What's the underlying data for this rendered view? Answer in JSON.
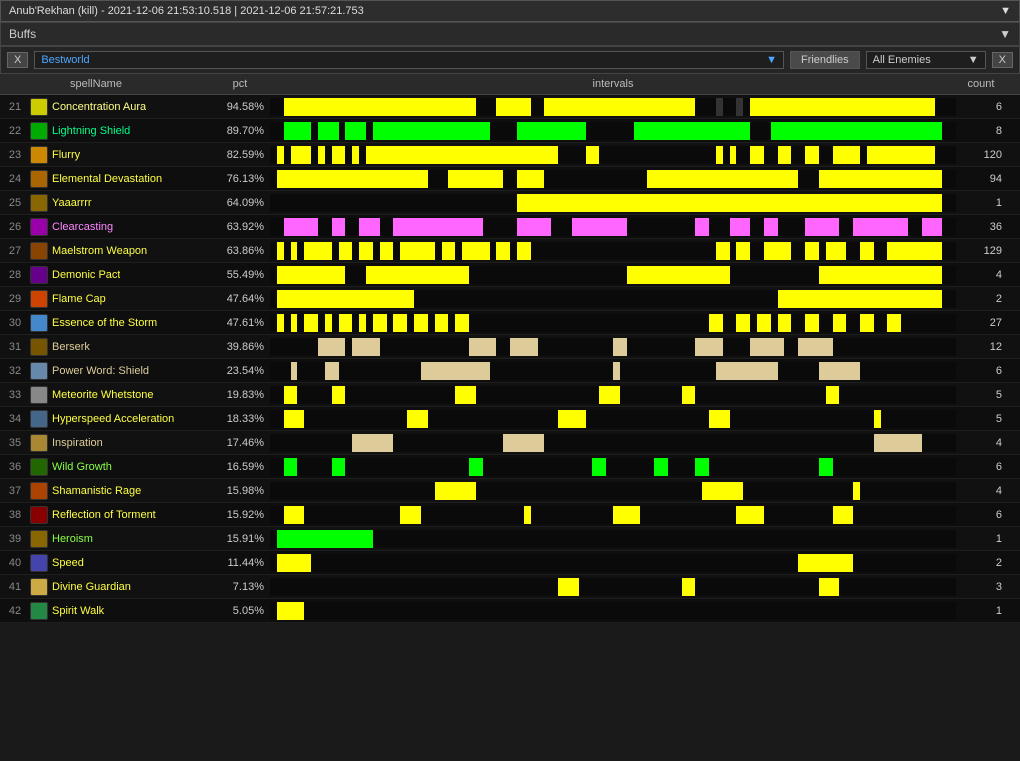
{
  "titleBar": {
    "text": "Anub'Rekhan (kill) - 2021-12-06 21:53:10.518 | 2021-12-06 21:57:21.753",
    "chevron": "▼"
  },
  "sectionHeader": {
    "label": "Buffs",
    "chevron": "▼"
  },
  "filterBar": {
    "xLabel": "X",
    "playerName": "Bestworld",
    "friendliesLabel": "Friendlies",
    "allEnemiesLabel": "All Enemies",
    "closeLabel": "X"
  },
  "tableHeader": {
    "spellName": "spellName",
    "pct": "pct",
    "intervals": "intervals",
    "count": "count"
  },
  "rows": [
    {
      "num": "21",
      "name": "Concentration Aura",
      "pct": "94.58%",
      "count": "6",
      "color": "#ffff00",
      "iconColor": "#cccc00",
      "nameColor": "#ffff88",
      "bars": [
        {
          "left": 0.02,
          "width": 0.28,
          "color": "#ffff00"
        },
        {
          "left": 0.33,
          "width": 0.05,
          "color": "#ffff00"
        },
        {
          "left": 0.4,
          "width": 0.22,
          "color": "#ffff00"
        },
        {
          "left": 0.65,
          "width": 0.01,
          "color": "#333"
        },
        {
          "left": 0.68,
          "width": 0.01,
          "color": "#333"
        },
        {
          "left": 0.7,
          "width": 0.27,
          "color": "#ffff00"
        }
      ]
    },
    {
      "num": "22",
      "name": "Lightning Shield",
      "pct": "89.70%",
      "count": "8",
      "color": "#00ff00",
      "iconColor": "#00aa00",
      "nameColor": "#00ff88",
      "bars": [
        {
          "left": 0.02,
          "width": 0.04,
          "color": "#00ff00"
        },
        {
          "left": 0.07,
          "width": 0.03,
          "color": "#00ff00"
        },
        {
          "left": 0.11,
          "width": 0.03,
          "color": "#00ff00"
        },
        {
          "left": 0.15,
          "width": 0.17,
          "color": "#00ff00"
        },
        {
          "left": 0.36,
          "width": 0.1,
          "color": "#00ff00"
        },
        {
          "left": 0.53,
          "width": 0.17,
          "color": "#00ff00"
        },
        {
          "left": 0.73,
          "width": 0.25,
          "color": "#00ff00"
        }
      ]
    },
    {
      "num": "23",
      "name": "Flurry",
      "pct": "82.59%",
      "count": "120",
      "color": "#ffff00",
      "iconColor": "#cc8800",
      "nameColor": "#ffff44",
      "bars": [
        {
          "left": 0.01,
          "width": 0.01,
          "color": "#ffff00"
        },
        {
          "left": 0.03,
          "width": 0.01,
          "color": "#ffff00"
        },
        {
          "left": 0.04,
          "width": 0.01,
          "color": "#ffff00"
        },
        {
          "left": 0.05,
          "width": 0.01,
          "color": "#ffff00"
        },
        {
          "left": 0.07,
          "width": 0.01,
          "color": "#ffff00"
        },
        {
          "left": 0.09,
          "width": 0.02,
          "color": "#ffff00"
        },
        {
          "left": 0.12,
          "width": 0.01,
          "color": "#ffff00"
        },
        {
          "left": 0.14,
          "width": 0.28,
          "color": "#ffff00"
        },
        {
          "left": 0.46,
          "width": 0.02,
          "color": "#ffff00"
        },
        {
          "left": 0.65,
          "width": 0.01,
          "color": "#ffff00"
        },
        {
          "left": 0.67,
          "width": 0.01,
          "color": "#ffff00"
        },
        {
          "left": 0.7,
          "width": 0.02,
          "color": "#ffff00"
        },
        {
          "left": 0.74,
          "width": 0.02,
          "color": "#ffff00"
        },
        {
          "left": 0.78,
          "width": 0.02,
          "color": "#ffff00"
        },
        {
          "left": 0.82,
          "width": 0.04,
          "color": "#ffff00"
        },
        {
          "left": 0.87,
          "width": 0.1,
          "color": "#ffff00"
        }
      ]
    },
    {
      "num": "24",
      "name": "Elemental Devastation",
      "pct": "76.13%",
      "count": "94",
      "color": "#ffff00",
      "iconColor": "#aa6600",
      "nameColor": "#ffff44",
      "bars": [
        {
          "left": 0.01,
          "width": 0.22,
          "color": "#ffff00"
        },
        {
          "left": 0.26,
          "width": 0.08,
          "color": "#ffff00"
        },
        {
          "left": 0.36,
          "width": 0.04,
          "color": "#ffff00"
        },
        {
          "left": 0.55,
          "width": 0.22,
          "color": "#ffff00"
        },
        {
          "left": 0.8,
          "width": 0.18,
          "color": "#ffff00"
        }
      ]
    },
    {
      "num": "25",
      "name": "Yaaarrrr",
      "pct": "64.09%",
      "count": "1",
      "color": "#ffff00",
      "iconColor": "#886600",
      "nameColor": "#ffff44",
      "bars": [
        {
          "left": 0.36,
          "width": 0.62,
          "color": "#ffff00"
        }
      ]
    },
    {
      "num": "26",
      "name": "Clearcasting",
      "pct": "63.92%",
      "count": "36",
      "color": "#ff66ff",
      "iconColor": "#9900aa",
      "nameColor": "#ff88ff",
      "bars": [
        {
          "left": 0.02,
          "width": 0.05,
          "color": "#ff66ff"
        },
        {
          "left": 0.09,
          "width": 0.02,
          "color": "#ff66ff"
        },
        {
          "left": 0.13,
          "width": 0.03,
          "color": "#ff66ff"
        },
        {
          "left": 0.18,
          "width": 0.13,
          "color": "#ff66ff"
        },
        {
          "left": 0.36,
          "width": 0.05,
          "color": "#ff66ff"
        },
        {
          "left": 0.44,
          "width": 0.08,
          "color": "#ff66ff"
        },
        {
          "left": 0.62,
          "width": 0.02,
          "color": "#ff66ff"
        },
        {
          "left": 0.67,
          "width": 0.03,
          "color": "#ff66ff"
        },
        {
          "left": 0.72,
          "width": 0.02,
          "color": "#ff66ff"
        },
        {
          "left": 0.78,
          "width": 0.05,
          "color": "#ff66ff"
        },
        {
          "left": 0.85,
          "width": 0.08,
          "color": "#ff66ff"
        },
        {
          "left": 0.95,
          "width": 0.03,
          "color": "#ff66ff"
        }
      ]
    },
    {
      "num": "27",
      "name": "Maelstrom Weapon",
      "pct": "63.86%",
      "count": "129",
      "color": "#ffff00",
      "iconColor": "#884400",
      "nameColor": "#ffff44",
      "bars": [
        {
          "left": 0.01,
          "width": 0.01,
          "color": "#ffff00"
        },
        {
          "left": 0.03,
          "width": 0.01,
          "color": "#ffff00"
        },
        {
          "left": 0.05,
          "width": 0.04,
          "color": "#ffff00"
        },
        {
          "left": 0.1,
          "width": 0.02,
          "color": "#ffff00"
        },
        {
          "left": 0.13,
          "width": 0.02,
          "color": "#ffff00"
        },
        {
          "left": 0.16,
          "width": 0.02,
          "color": "#ffff00"
        },
        {
          "left": 0.19,
          "width": 0.05,
          "color": "#ffff00"
        },
        {
          "left": 0.25,
          "width": 0.02,
          "color": "#ffff00"
        },
        {
          "left": 0.28,
          "width": 0.04,
          "color": "#ffff00"
        },
        {
          "left": 0.33,
          "width": 0.02,
          "color": "#ffff00"
        },
        {
          "left": 0.36,
          "width": 0.02,
          "color": "#ffff00"
        },
        {
          "left": 0.65,
          "width": 0.02,
          "color": "#ffff00"
        },
        {
          "left": 0.68,
          "width": 0.02,
          "color": "#ffff00"
        },
        {
          "left": 0.72,
          "width": 0.04,
          "color": "#ffff00"
        },
        {
          "left": 0.78,
          "width": 0.02,
          "color": "#ffff00"
        },
        {
          "left": 0.81,
          "width": 0.03,
          "color": "#ffff00"
        },
        {
          "left": 0.86,
          "width": 0.02,
          "color": "#ffff00"
        },
        {
          "left": 0.9,
          "width": 0.08,
          "color": "#ffff00"
        }
      ]
    },
    {
      "num": "28",
      "name": "Demonic Pact",
      "pct": "55.49%",
      "count": "4",
      "color": "#ffff00",
      "iconColor": "#660088",
      "nameColor": "#ffff44",
      "bars": [
        {
          "left": 0.01,
          "width": 0.1,
          "color": "#ffff00"
        },
        {
          "left": 0.14,
          "width": 0.15,
          "color": "#ffff00"
        },
        {
          "left": 0.52,
          "width": 0.15,
          "color": "#ffff00"
        },
        {
          "left": 0.8,
          "width": 0.18,
          "color": "#ffff00"
        }
      ]
    },
    {
      "num": "29",
      "name": "Flame Cap",
      "pct": "47.64%",
      "count": "2",
      "color": "#ffff00",
      "iconColor": "#cc4400",
      "nameColor": "#ffff44",
      "bars": [
        {
          "left": 0.01,
          "width": 0.2,
          "color": "#ffff00"
        },
        {
          "left": 0.74,
          "width": 0.24,
          "color": "#ffff00"
        }
      ]
    },
    {
      "num": "30",
      "name": "Essence of the Storm",
      "pct": "47.61%",
      "count": "27",
      "color": "#ffff00",
      "iconColor": "#4488cc",
      "nameColor": "#ffff44",
      "bars": [
        {
          "left": 0.01,
          "width": 0.01,
          "color": "#ffff00"
        },
        {
          "left": 0.03,
          "width": 0.01,
          "color": "#ffff00"
        },
        {
          "left": 0.05,
          "width": 0.02,
          "color": "#ffff00"
        },
        {
          "left": 0.08,
          "width": 0.01,
          "color": "#ffff00"
        },
        {
          "left": 0.1,
          "width": 0.02,
          "color": "#ffff00"
        },
        {
          "left": 0.13,
          "width": 0.01,
          "color": "#ffff00"
        },
        {
          "left": 0.15,
          "width": 0.02,
          "color": "#ffff00"
        },
        {
          "left": 0.18,
          "width": 0.02,
          "color": "#ffff00"
        },
        {
          "left": 0.21,
          "width": 0.02,
          "color": "#ffff00"
        },
        {
          "left": 0.24,
          "width": 0.02,
          "color": "#ffff00"
        },
        {
          "left": 0.27,
          "width": 0.02,
          "color": "#ffff00"
        },
        {
          "left": 0.64,
          "width": 0.02,
          "color": "#ffff00"
        },
        {
          "left": 0.68,
          "width": 0.02,
          "color": "#ffff00"
        },
        {
          "left": 0.71,
          "width": 0.02,
          "color": "#ffff00"
        },
        {
          "left": 0.74,
          "width": 0.02,
          "color": "#ffff00"
        },
        {
          "left": 0.78,
          "width": 0.02,
          "color": "#ffff00"
        },
        {
          "left": 0.82,
          "width": 0.02,
          "color": "#ffff00"
        },
        {
          "left": 0.86,
          "width": 0.02,
          "color": "#ffff00"
        },
        {
          "left": 0.9,
          "width": 0.02,
          "color": "#ffff00"
        }
      ]
    },
    {
      "num": "31",
      "name": "Berserk",
      "pct": "39.86%",
      "count": "12",
      "color": "#ddcc99",
      "iconColor": "#775500",
      "nameColor": "#ddcc99",
      "bars": [
        {
          "left": 0.07,
          "width": 0.04,
          "color": "#ddcc99"
        },
        {
          "left": 0.12,
          "width": 0.04,
          "color": "#ddcc99"
        },
        {
          "left": 0.29,
          "width": 0.04,
          "color": "#ddcc99"
        },
        {
          "left": 0.35,
          "width": 0.04,
          "color": "#ddcc99"
        },
        {
          "left": 0.5,
          "width": 0.02,
          "color": "#ddcc99"
        },
        {
          "left": 0.62,
          "width": 0.04,
          "color": "#ddcc99"
        },
        {
          "left": 0.7,
          "width": 0.05,
          "color": "#ddcc99"
        },
        {
          "left": 0.77,
          "width": 0.05,
          "color": "#ddcc99"
        }
      ]
    },
    {
      "num": "32",
      "name": "Power Word: Shield",
      "pct": "23.54%",
      "count": "6",
      "color": "#ddcc99",
      "iconColor": "#6688aa",
      "nameColor": "#ddcc99",
      "bars": [
        {
          "left": 0.03,
          "width": 0.01,
          "color": "#ddcc99"
        },
        {
          "left": 0.08,
          "width": 0.02,
          "color": "#ddcc99"
        },
        {
          "left": 0.22,
          "width": 0.1,
          "color": "#ddcc99"
        },
        {
          "left": 0.5,
          "width": 0.01,
          "color": "#ddcc99"
        },
        {
          "left": 0.65,
          "width": 0.09,
          "color": "#ddcc99"
        },
        {
          "left": 0.8,
          "width": 0.06,
          "color": "#ddcc99"
        }
      ]
    },
    {
      "num": "33",
      "name": "Meteorite Whetstone",
      "pct": "19.83%",
      "count": "5",
      "color": "#ffff00",
      "iconColor": "#888888",
      "nameColor": "#ffff44",
      "bars": [
        {
          "left": 0.02,
          "width": 0.02,
          "color": "#ffff00"
        },
        {
          "left": 0.09,
          "width": 0.02,
          "color": "#ffff00"
        },
        {
          "left": 0.27,
          "width": 0.03,
          "color": "#ffff00"
        },
        {
          "left": 0.48,
          "width": 0.03,
          "color": "#ffff00"
        },
        {
          "left": 0.6,
          "width": 0.02,
          "color": "#ffff00"
        },
        {
          "left": 0.81,
          "width": 0.02,
          "color": "#ffff00"
        }
      ]
    },
    {
      "num": "34",
      "name": "Hyperspeed Acceleration",
      "pct": "18.33%",
      "count": "5",
      "color": "#ffff00",
      "iconColor": "#446688",
      "nameColor": "#ffff44",
      "bars": [
        {
          "left": 0.02,
          "width": 0.03,
          "color": "#ffff00"
        },
        {
          "left": 0.2,
          "width": 0.03,
          "color": "#ffff00"
        },
        {
          "left": 0.42,
          "width": 0.04,
          "color": "#ffff00"
        },
        {
          "left": 0.64,
          "width": 0.03,
          "color": "#ffff00"
        },
        {
          "left": 0.88,
          "width": 0.01,
          "color": "#ffff00"
        }
      ]
    },
    {
      "num": "35",
      "name": "Inspiration",
      "pct": "17.46%",
      "count": "4",
      "color": "#ddcc99",
      "iconColor": "#aa8833",
      "nameColor": "#ddcc99",
      "bars": [
        {
          "left": 0.12,
          "width": 0.06,
          "color": "#ddcc99"
        },
        {
          "left": 0.34,
          "width": 0.06,
          "color": "#ddcc99"
        },
        {
          "left": 0.88,
          "width": 0.07,
          "color": "#ddcc99"
        }
      ]
    },
    {
      "num": "36",
      "name": "Wild Growth",
      "pct": "16.59%",
      "count": "6",
      "color": "#00ff00",
      "iconColor": "#226600",
      "nameColor": "#88ff44",
      "bars": [
        {
          "left": 0.02,
          "width": 0.02,
          "color": "#00ff00"
        },
        {
          "left": 0.09,
          "width": 0.02,
          "color": "#00ff00"
        },
        {
          "left": 0.29,
          "width": 0.02,
          "color": "#00ff00"
        },
        {
          "left": 0.47,
          "width": 0.02,
          "color": "#00ff00"
        },
        {
          "left": 0.56,
          "width": 0.02,
          "color": "#00ff00"
        },
        {
          "left": 0.62,
          "width": 0.02,
          "color": "#00ff00"
        },
        {
          "left": 0.8,
          "width": 0.02,
          "color": "#00ff00"
        }
      ]
    },
    {
      "num": "37",
      "name": "Shamanistic Rage",
      "pct": "15.98%",
      "count": "4",
      "color": "#ffff00",
      "iconColor": "#aa4400",
      "nameColor": "#ffff44",
      "bars": [
        {
          "left": 0.24,
          "width": 0.06,
          "color": "#ffff00"
        },
        {
          "left": 0.63,
          "width": 0.06,
          "color": "#ffff00"
        },
        {
          "left": 0.85,
          "width": 0.01,
          "color": "#ffff00"
        }
      ]
    },
    {
      "num": "38",
      "name": "Reflection of Torment",
      "pct": "15.92%",
      "count": "6",
      "color": "#ffff00",
      "iconColor": "#880000",
      "nameColor": "#ffff44",
      "bars": [
        {
          "left": 0.02,
          "width": 0.03,
          "color": "#ffff00"
        },
        {
          "left": 0.19,
          "width": 0.03,
          "color": "#ffff00"
        },
        {
          "left": 0.37,
          "width": 0.01,
          "color": "#ffff00"
        },
        {
          "left": 0.5,
          "width": 0.04,
          "color": "#ffff00"
        },
        {
          "left": 0.68,
          "width": 0.04,
          "color": "#ffff00"
        },
        {
          "left": 0.82,
          "width": 0.03,
          "color": "#ffff00"
        }
      ]
    },
    {
      "num": "39",
      "name": "Heroism",
      "pct": "15.91%",
      "count": "1",
      "color": "#00ff00",
      "iconColor": "#886600",
      "nameColor": "#88ff44",
      "bars": [
        {
          "left": 0.01,
          "width": 0.14,
          "color": "#00ff00"
        }
      ]
    },
    {
      "num": "40",
      "name": "Speed",
      "pct": "11.44%",
      "count": "2",
      "color": "#ffff00",
      "iconColor": "#4444aa",
      "nameColor": "#ffff44",
      "bars": [
        {
          "left": 0.01,
          "width": 0.05,
          "color": "#ffff00"
        },
        {
          "left": 0.77,
          "width": 0.08,
          "color": "#ffff00"
        }
      ]
    },
    {
      "num": "41",
      "name": "Divine Guardian",
      "pct": "7.13%",
      "count": "3",
      "color": "#ffff00",
      "iconColor": "#ccaa44",
      "nameColor": "#ffff44",
      "bars": [
        {
          "left": 0.42,
          "width": 0.03,
          "color": "#ffff00"
        },
        {
          "left": 0.6,
          "width": 0.02,
          "color": "#ffff00"
        },
        {
          "left": 0.8,
          "width": 0.03,
          "color": "#ffff00"
        }
      ]
    },
    {
      "num": "42",
      "name": "Spirit Walk",
      "pct": "5.05%",
      "count": "1",
      "color": "#ffff00",
      "iconColor": "#228844",
      "nameColor": "#ffff44",
      "bars": [
        {
          "left": 0.01,
          "width": 0.04,
          "color": "#ffff00"
        }
      ]
    }
  ]
}
